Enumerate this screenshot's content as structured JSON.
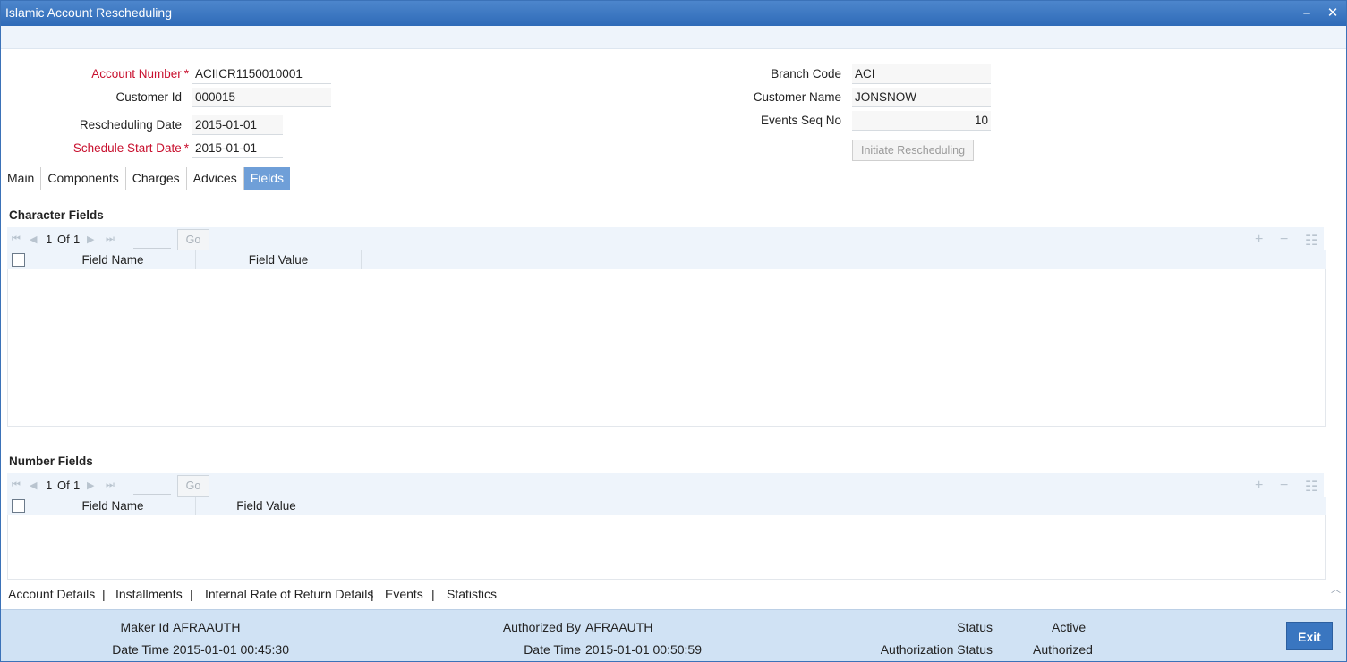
{
  "window": {
    "title": "Islamic Account Rescheduling",
    "minimize_glyph": "–",
    "close_glyph": "✕"
  },
  "form": {
    "account_number": {
      "label": "Account Number",
      "value": "ACIICR1150010001"
    },
    "customer_id": {
      "label": "Customer Id",
      "value": "000015"
    },
    "rescheduling_date": {
      "label": "Rescheduling Date",
      "value": "2015-01-01"
    },
    "schedule_start_date": {
      "label": "Schedule Start Date",
      "value": "2015-01-01"
    },
    "branch_code": {
      "label": "Branch Code",
      "value": "ACI"
    },
    "customer_name": {
      "label": "Customer Name",
      "value": "JONSNOW"
    },
    "events_seq_no": {
      "label": "Events Seq No",
      "value": "10"
    },
    "required_mark": "*",
    "initiate_button": "Initiate Rescheduling"
  },
  "tabs": [
    {
      "label": "Main"
    },
    {
      "label": "Components"
    },
    {
      "label": "Charges"
    },
    {
      "label": "Advices"
    },
    {
      "label": "Fields",
      "active": true
    }
  ],
  "character_fields": {
    "title": "Character Fields",
    "page": "1",
    "of_label": "Of",
    "total_pages": "1",
    "go_label": "Go",
    "columns": [
      "Field Name",
      "Field Value"
    ]
  },
  "number_fields": {
    "title": "Number Fields",
    "page": "1",
    "of_label": "Of",
    "total_pages": "1",
    "go_label": "Go",
    "columns": [
      "Field Name",
      "Field Value"
    ]
  },
  "bottom_links": [
    "Account Details",
    "Installments",
    "Internal Rate of Return Details",
    "Events",
    "Statistics"
  ],
  "link_separator": "|",
  "footer": {
    "maker_id_label": "Maker Id",
    "maker_id": "AFRAAUTH",
    "maker_datetime_label": "Date Time",
    "maker_datetime": "2015-01-01 00:45:30",
    "authorized_by_label": "Authorized By",
    "authorized_by": "AFRAAUTH",
    "auth_datetime_label": "Date Time",
    "auth_datetime": "2015-01-01 00:50:59",
    "status_label": "Status",
    "status": "Active",
    "auth_status_label": "Authorization Status",
    "auth_status": "Authorized",
    "exit_label": "Exit"
  },
  "colors": {
    "titlebar": "#2f6bb8",
    "required": "#c8102e",
    "active_tab": "#6f9fd8",
    "footer": "#d0e2f4",
    "exit_button": "#3a76c0"
  }
}
